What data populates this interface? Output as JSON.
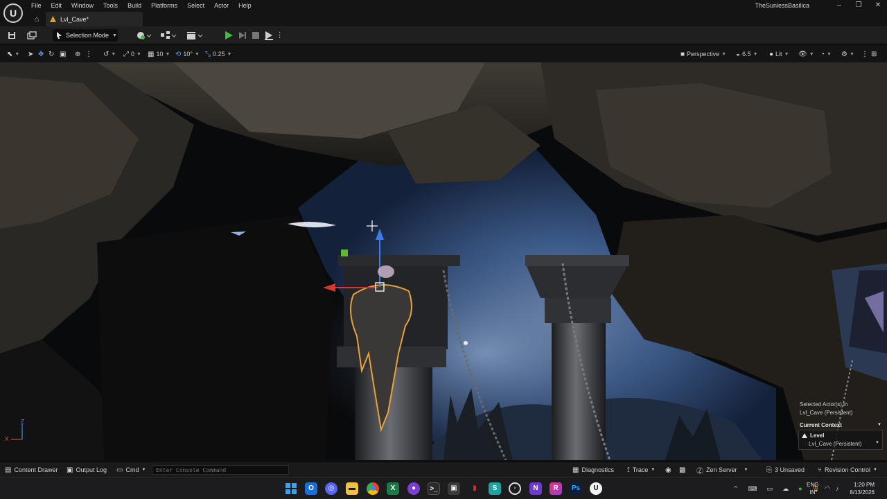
{
  "menu": {
    "items": [
      "File",
      "Edit",
      "Window",
      "Tools",
      "Build",
      "Platforms",
      "Select",
      "Actor",
      "Help"
    ],
    "project_name": "TheSunlessBasilica"
  },
  "tabs": {
    "level_tab": "Lvl_Cave*"
  },
  "toolbar": {
    "selection_mode": "Selection Mode"
  },
  "viewport_toolbar": {
    "rotation_snap": "0",
    "grid_snap": "10",
    "angle_snap": "10°",
    "scale_snap": "0.25",
    "view_mode": "Perspective",
    "camera_speed": "6.5",
    "lighting": "Lit"
  },
  "viewport": {
    "axis_z": "Z",
    "axis_x": "X",
    "selected_line1": "Selected Actor(s) in",
    "selected_line2": "Lvl_Cave (Persistent)",
    "current_context": "Current Context",
    "level_label": "Level",
    "level_value": "Lvl_Cave (Persistent)"
  },
  "statusbar": {
    "content_drawer": "Content Drawer",
    "output_log": "Output Log",
    "cmd": "Cmd",
    "console_placeholder": "Enter Console Command",
    "diagnostics": "Diagnostics",
    "trace": "Trace",
    "zen_server": "Zen Server",
    "unsaved": "3 Unsaved",
    "revision_control": "Revision Control"
  },
  "taskbar": {
    "apps": [
      "start",
      "outlook",
      "discord",
      "file-explorer",
      "chrome",
      "excel",
      "github",
      "terminal",
      "app-icon",
      "app-icon-red",
      "app-icon-teal",
      "app-icon-circle",
      "visual-studio",
      "rider",
      "photoshop",
      "unreal"
    ],
    "lang_line1": "ENG",
    "lang_line2": "IN",
    "time": "1:20 PM",
    "date": "8/13/2026"
  },
  "colors": {
    "accent_play": "#3fbf3f",
    "selection_outline": "#e8a23a",
    "gizmo_z": "#3d7ee6",
    "gizmo_x": "#d43a2a",
    "gizmo_y": "#5fb83a"
  }
}
